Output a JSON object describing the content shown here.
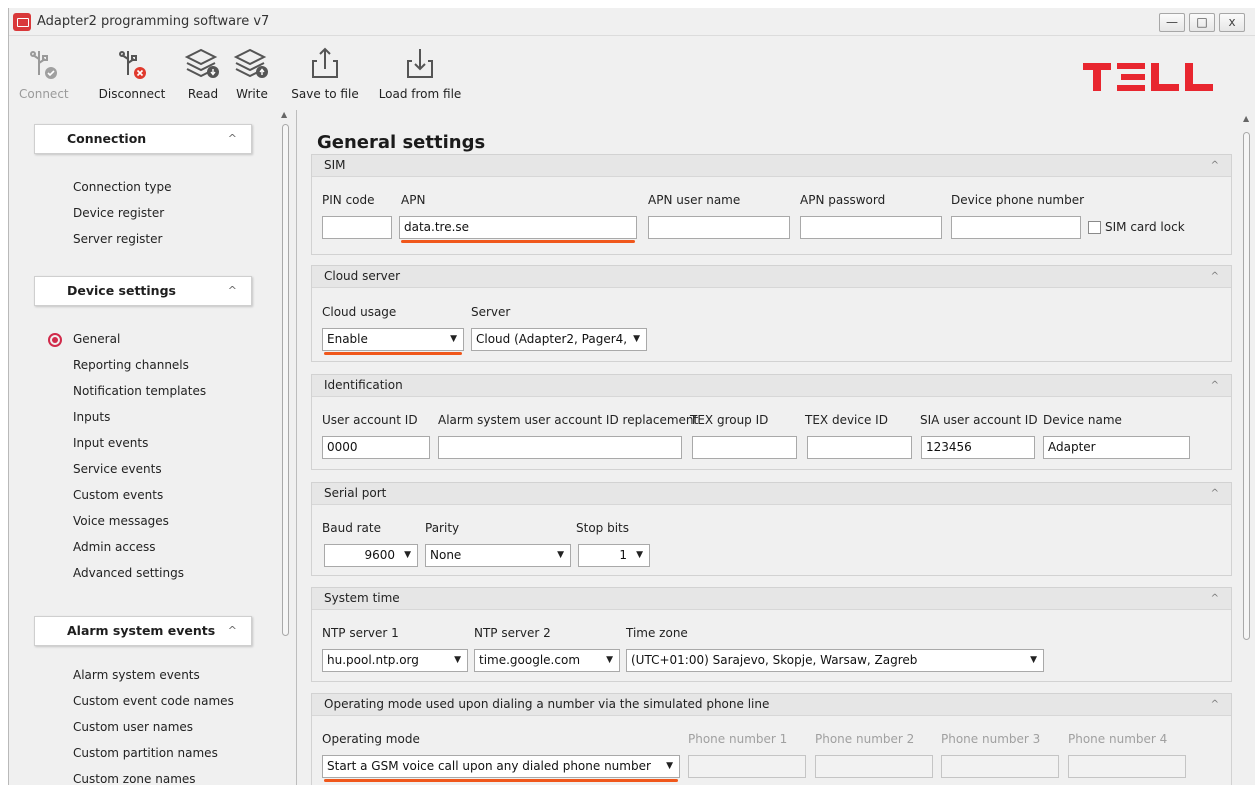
{
  "window": {
    "title": "Adapter2 programming software v7",
    "minimize": "—",
    "maximize": "□",
    "close": "x"
  },
  "toolbar": {
    "connect_label": "Connect",
    "disconnect_label": "Disconnect",
    "read_label": "Read",
    "write_label": "Write",
    "save_label": "Save to file",
    "load_label": "Load from file"
  },
  "logo": {
    "text": "TELL",
    "color": "#e8262f"
  },
  "sidebar": {
    "groups": [
      {
        "label": "Connection",
        "items": [
          "Connection type",
          "Device register",
          "Server register"
        ]
      },
      {
        "label": "Device settings",
        "items": [
          "General",
          "Reporting channels",
          "Notification templates",
          "Inputs",
          "Input events",
          "Service events",
          "Custom events",
          "Voice messages",
          "Admin access",
          "Advanced settings"
        ]
      },
      {
        "label": "Alarm system events",
        "items": [
          "Alarm system events",
          "Custom event code names",
          "Custom user names",
          "Custom partition names",
          "Custom zone names"
        ]
      }
    ],
    "active_item": "General",
    "collapse_glyph": "^"
  },
  "main": {
    "title": "General settings",
    "sim": {
      "header": "SIM",
      "pin_label": "PIN code",
      "pin_value": "",
      "apn_label": "APN",
      "apn_value": "data.tre.se",
      "apn_user_label": "APN user name",
      "apn_user_value": "",
      "apn_password_label": "APN password",
      "apn_password_value": "",
      "phone_label": "Device phone number",
      "phone_value": "",
      "lock_label": "SIM card lock",
      "lock_checked": false
    },
    "cloud": {
      "header": "Cloud server",
      "usage_label": "Cloud usage",
      "usage_value": "Enable",
      "server_label": "Server",
      "server_value": "Cloud (Adapter2, Pager4,"
    },
    "identification": {
      "header": "Identification",
      "user_account_label": "User account ID",
      "user_account_value": "0000",
      "replacement_label": "Alarm system user account ID replacement",
      "replacement_value": "",
      "tex_group_label": "TEX group ID",
      "tex_group_value": "",
      "tex_device_label": "TEX device ID",
      "tex_device_value": "",
      "sia_label": "SIA user account ID",
      "sia_value": "123456",
      "device_name_label": "Device name",
      "device_name_value": "Adapter"
    },
    "serial": {
      "header": "Serial port",
      "baud_label": "Baud rate",
      "baud_value": "9600",
      "parity_label": "Parity",
      "parity_value": "None",
      "stop_label": "Stop bits",
      "stop_value": "1"
    },
    "time": {
      "header": "System time",
      "ntp1_label": "NTP server 1",
      "ntp1_value": "hu.pool.ntp.org",
      "ntp2_label": "NTP server 2",
      "ntp2_value": "time.google.com",
      "tz_label": "Time zone",
      "tz_value": "(UTC+01:00) Sarajevo, Skopje, Warsaw, Zagreb"
    },
    "operating": {
      "header": "Operating mode used upon dialing a number via the simulated phone line",
      "mode_label": "Operating mode",
      "mode_value": "Start a GSM voice call upon any dialed phone number",
      "phone1_label": "Phone number 1",
      "phone2_label": "Phone number 2",
      "phone3_label": "Phone number 3",
      "phone4_label": "Phone number 4"
    },
    "dropdown_glyph": "▼",
    "collapse_glyph": "^"
  },
  "colors": {
    "accent": "#d12a4a",
    "highlight_underline": "#f0571b"
  },
  "icons": [
    "usb-connect-icon",
    "usb-disconnect-icon",
    "read-layers-icon",
    "write-layers-icon",
    "export-icon",
    "import-icon"
  ]
}
